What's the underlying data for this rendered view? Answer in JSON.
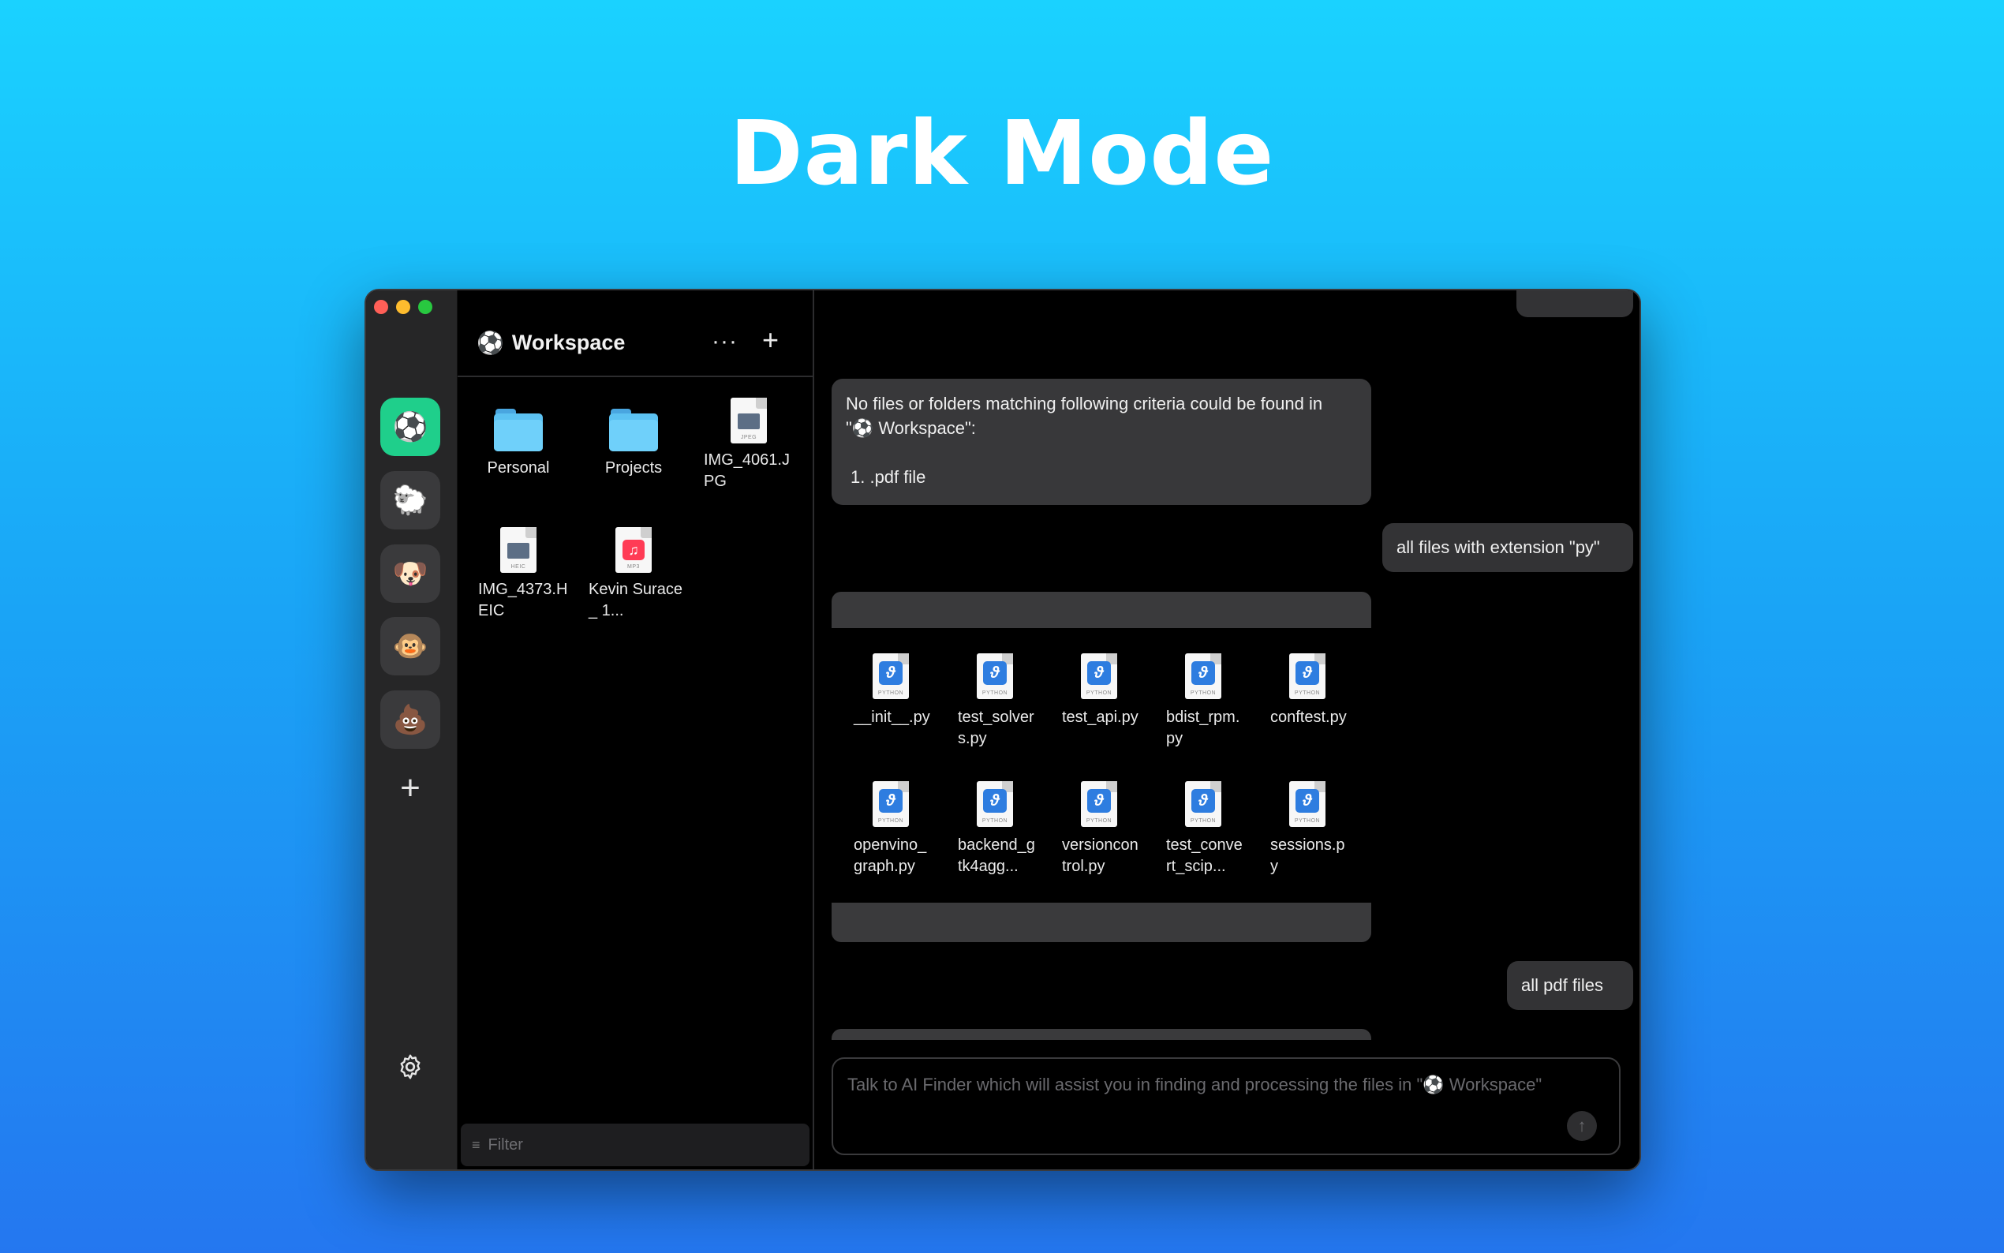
{
  "hero": {
    "title": "Dark Mode"
  },
  "rail": {
    "spaces": [
      {
        "emoji": "⚽",
        "active": true
      },
      {
        "emoji": "🐑",
        "active": false
      },
      {
        "emoji": "🐶",
        "active": false
      },
      {
        "emoji": "🐵",
        "active": false
      },
      {
        "emoji": "💩",
        "active": false
      }
    ],
    "add_label": "+"
  },
  "panel": {
    "workspace_emoji": "⚽",
    "workspace_title": "Workspace",
    "more_label": "···",
    "add_label": "+",
    "files": [
      {
        "name": "Personal",
        "kind": "folder"
      },
      {
        "name": "Projects",
        "kind": "folder"
      },
      {
        "name": "IMG_4061.JPG",
        "kind": "image",
        "tag": "JPEG"
      },
      {
        "name": "IMG_4373.HEIC",
        "kind": "image",
        "tag": "HEIC"
      },
      {
        "name": "Kevin Surace_ 1...",
        "kind": "audio",
        "tag": "MP3"
      }
    ],
    "filter_placeholder": "Filter"
  },
  "chat": {
    "ai_message": {
      "line1": "No files or folders matching following criteria could be found in",
      "line2": "\"⚽ Workspace\":",
      "criteria": "1. .pdf file"
    },
    "user_message_1": "all files with extension \"py\"",
    "py_files": [
      "__init__.py",
      "test_solvers.py",
      "test_api.py",
      "bdist_rpm.py",
      "conftest.py",
      "openvino_graph.py",
      "backend_gtk4agg...",
      "versioncontrol.py",
      "test_convert_scip...",
      "sessions.py"
    ],
    "py_tag": "PYTHON",
    "user_message_2": "all pdf files",
    "composer_placeholder": "Talk to AI Finder which will assist you in finding and processing the files in \"⚽ Workspace\"",
    "send_label": "↑"
  }
}
